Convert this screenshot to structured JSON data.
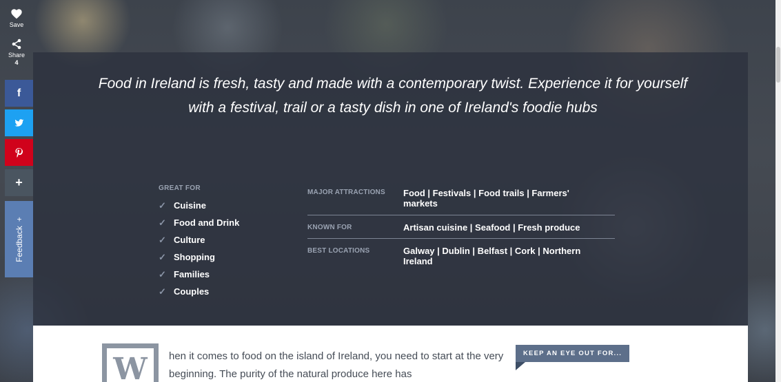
{
  "social": {
    "save_label": "Save",
    "share_label": "Share",
    "share_count": "4",
    "facebook_glyph": "f",
    "twitter_glyph": "🐦",
    "pinterest_glyph": "℗",
    "more_glyph": "+",
    "feedback_label": "Feedback",
    "feedback_plus": "+"
  },
  "intro": {
    "text": "Food in Ireland is fresh, tasty and made with a contemporary twist. Experience it for yourself with a festival, trail or a tasty dish in one of Ireland's foodie hubs"
  },
  "great_for": {
    "title": "GREAT FOR",
    "items": [
      "Cuisine",
      "Food and Drink",
      "Culture",
      "Shopping",
      "Families",
      "Couples"
    ]
  },
  "facts": [
    {
      "label": "MAJOR ATTRACTIONS",
      "value": "Food | Festivals | Food trails | Farmers' markets"
    },
    {
      "label": "KNOWN FOR",
      "value": "Artisan cuisine | Seafood | Fresh produce"
    },
    {
      "label": "BEST LOCATIONS",
      "value": "Galway | Dublin | Belfast | Cork | Northern Ireland"
    }
  ],
  "article": {
    "dropcap": "W",
    "text": "hen it comes to food on the island of Ireland, you need to start at the very beginning. The purity of the natural produce here has"
  },
  "sidebar_tag": {
    "label": "KEEP AN EYE OUT FOR..."
  },
  "colors": {
    "facebook": "#3b5998",
    "twitter": "#1da1f2",
    "pinterest": "#d0021b",
    "feedback": "#5b7eb3",
    "overlay": "#2b313b",
    "tag": "#5d6f8a"
  }
}
